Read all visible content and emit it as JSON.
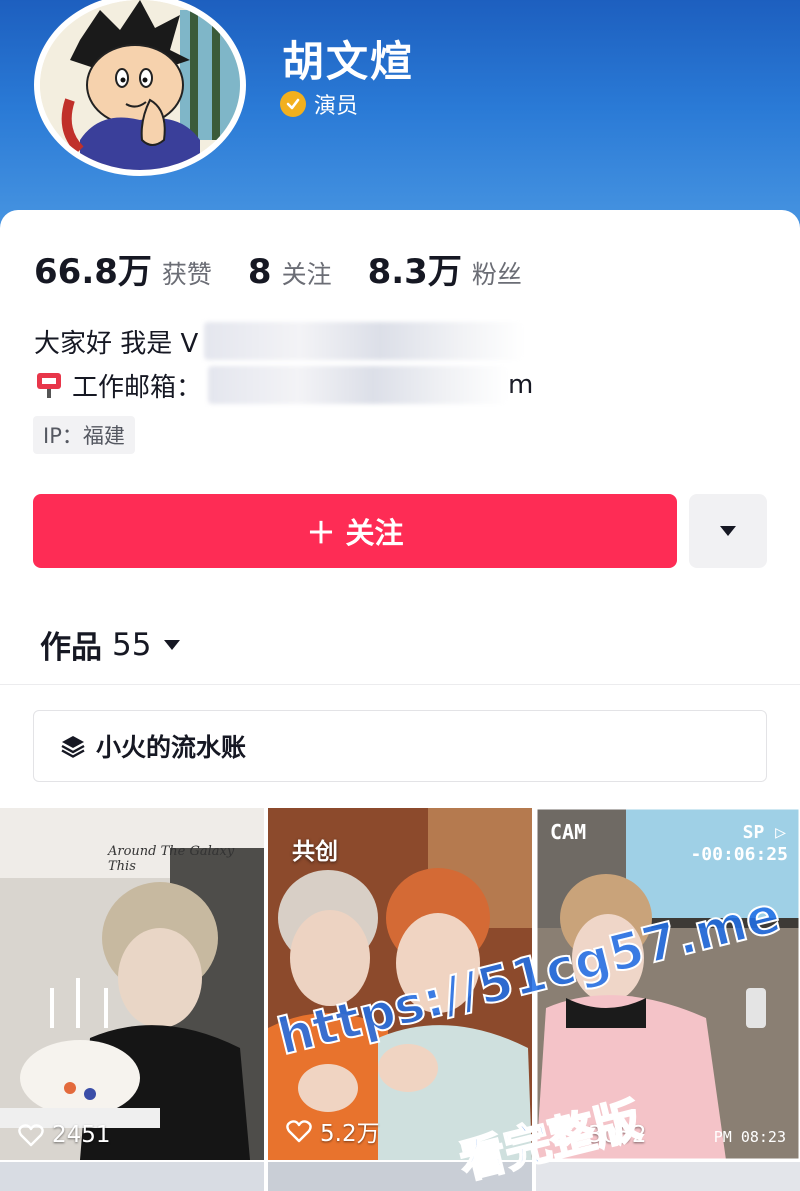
{
  "profile": {
    "name": "胡文煊",
    "verification": "演员"
  },
  "stats": [
    {
      "value": "66.8万",
      "label": "获赞"
    },
    {
      "value": "8",
      "label": "关注"
    },
    {
      "value": "8.3万",
      "label": "粉丝"
    }
  ],
  "bio": {
    "line1": "大家好 我是 V",
    "line2_label": "工作邮箱：",
    "line2_tail": "m"
  },
  "ip_tag": "IP：福建",
  "actions": {
    "follow_label": "＋ 关注"
  },
  "works_tab": {
    "label": "作品",
    "count": "55"
  },
  "collection": {
    "label": "小火的流水账"
  },
  "videos": [
    {
      "likes": "2451",
      "caption": "Around The Galaxy This"
    },
    {
      "likes": "5.2万",
      "badge": "共创"
    },
    {
      "likes": "3052",
      "cam": "CAM",
      "sp": "SP ▷",
      "time": "-00:06:25",
      "pm": "PM 08:23"
    }
  ],
  "watermark": {
    "url": "https://51cg57.me",
    "text": "看完整版"
  },
  "colors": {
    "header_blue": "#2a7ad6",
    "follow_red": "#fe2c55",
    "verify_gold": "#f2b01e"
  }
}
